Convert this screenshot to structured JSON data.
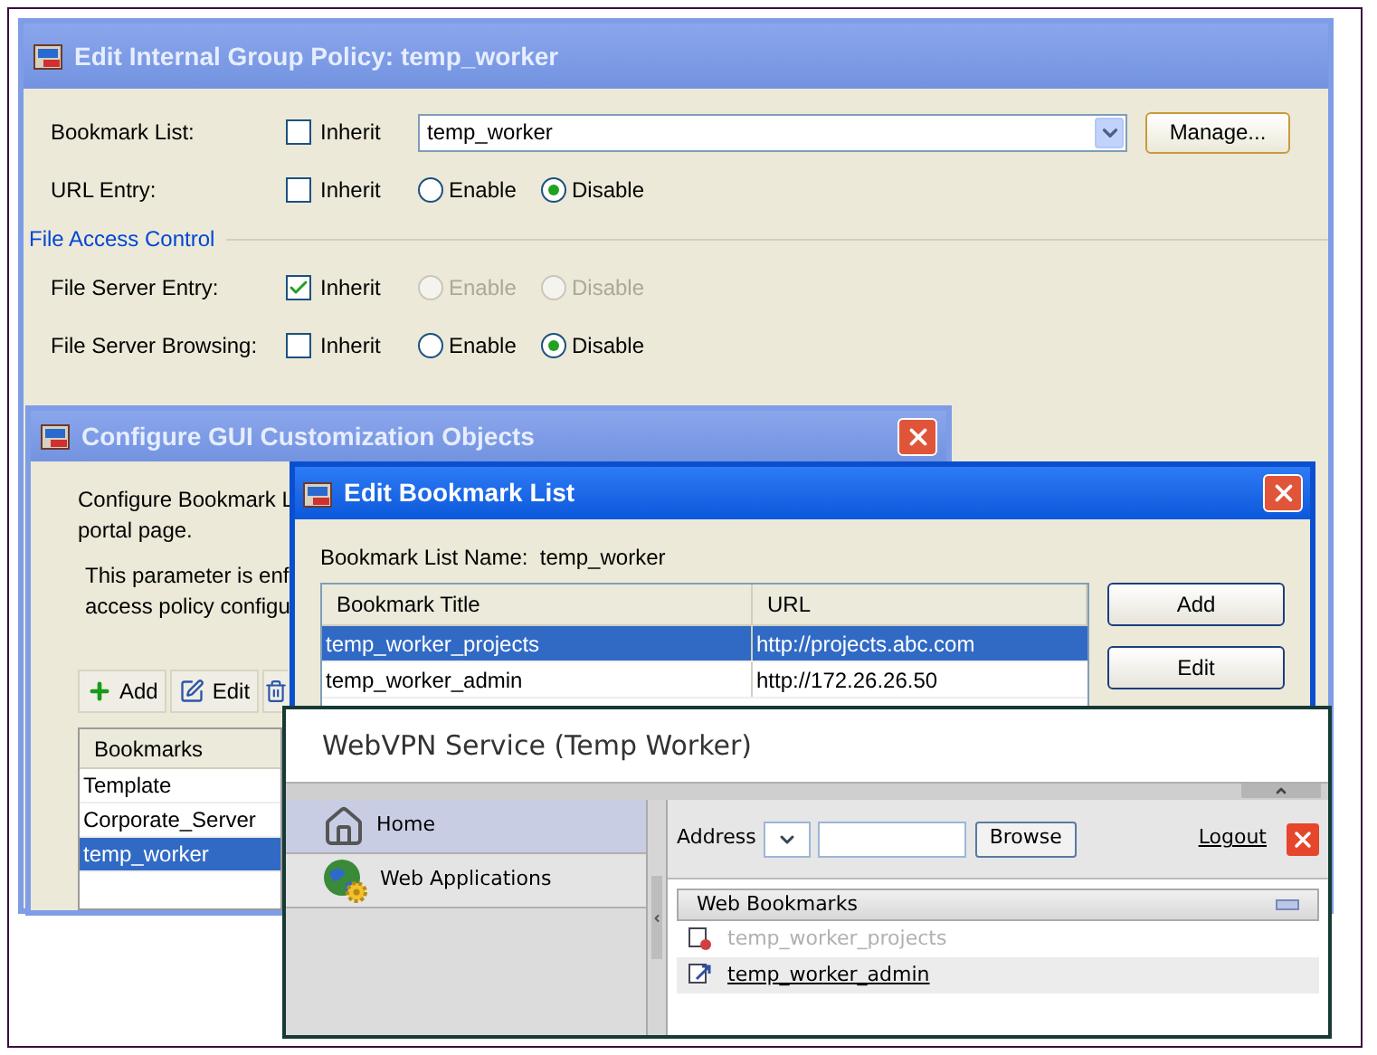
{
  "policy_window": {
    "title": "Edit Internal Group Policy: temp_worker",
    "rows": [
      {
        "kind": "dropdown",
        "label": "Bookmark List:",
        "inherit": false,
        "inherit_label": "Inherit",
        "value": "temp_worker",
        "button": "Manage..."
      },
      {
        "kind": "radio",
        "label": "URL Entry:",
        "inherit": false,
        "inherit_label": "Inherit",
        "options": [
          {
            "label": "Enable",
            "selected": false,
            "disabled": false
          },
          {
            "label": "Disable",
            "selected": true,
            "disabled": false
          }
        ]
      }
    ],
    "section": {
      "title": "File Access Control",
      "rows": [
        {
          "kind": "radio",
          "label": "File Server Entry:",
          "inherit": true,
          "inherit_label": "Inherit",
          "options": [
            {
              "label": "Enable",
              "selected": false,
              "disabled": true
            },
            {
              "label": "Disable",
              "selected": false,
              "disabled": true
            }
          ]
        },
        {
          "kind": "radio",
          "label": "File Server Browsing:",
          "inherit": false,
          "inherit_label": "Inherit",
          "options": [
            {
              "label": "Enable",
              "selected": false,
              "disabled": false
            },
            {
              "label": "Disable",
              "selected": true,
              "disabled": false
            }
          ]
        }
      ]
    }
  },
  "gui_window": {
    "title": "Configure GUI Customization Objects",
    "description": [
      "Configure Bookmark L",
      "portal page."
    ],
    "note": [
      "This parameter is enf",
      "access policy configu"
    ],
    "toolbar": [
      {
        "kind": "add",
        "label": "Add"
      },
      {
        "kind": "edit",
        "label": "Edit"
      },
      {
        "kind": "delete"
      }
    ],
    "table": {
      "columns": [
        "Bookmarks"
      ],
      "rows": [
        {
          "name": "Template",
          "selected": false
        },
        {
          "name": "Corporate_Server",
          "selected": false
        },
        {
          "name": "temp_worker",
          "selected": true
        }
      ]
    }
  },
  "bookmark_window": {
    "title": "Edit Bookmark List",
    "name_label": "Bookmark List Name:",
    "name_value": "temp_worker",
    "table": {
      "columns": [
        "Bookmark Title",
        "URL"
      ],
      "rows": [
        {
          "title": "temp_worker_projects",
          "url": "http://projects.abc.com",
          "selected": true
        },
        {
          "title": "temp_worker_admin",
          "url": "http://172.26.26.50",
          "selected": false
        }
      ]
    },
    "buttons": [
      "Add",
      "Edit"
    ]
  },
  "webvpn": {
    "title": "WebVPN Service (Temp Worker)",
    "nav": [
      {
        "kind": "home",
        "label": "Home",
        "selected": true
      },
      {
        "kind": "apps",
        "label": "Web Applications",
        "selected": false
      }
    ],
    "address_label": "Address",
    "browse": "Browse",
    "logout": "Logout",
    "bookmarks": {
      "title": "Web Bookmarks",
      "items": [
        {
          "label": "temp_worker_projects",
          "disabled": true,
          "highlighted": false
        },
        {
          "label": "temp_worker_admin",
          "disabled": false,
          "highlighted": true
        }
      ]
    }
  }
}
